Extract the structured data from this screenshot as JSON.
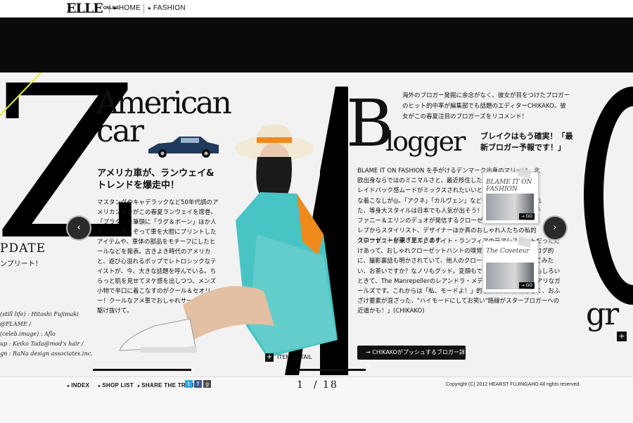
{
  "nav": {
    "logo": "ELLE",
    "logo_sub": "ONLINE",
    "home": "HOME",
    "fashion": "FASHION"
  },
  "left_page": {
    "big_letter": "Z",
    "update_title": "PDATE",
    "update_sub": "ンプリート！",
    "credits": [
      "(still life) : Hitoshi Fujimaki @FLAME /",
      "(celeb.image) : Aflo",
      "up : Keiko Tada@mod's hair /",
      "gn : RaNa design associates.inc."
    ]
  },
  "article_left": {
    "heading_1": "American",
    "heading_2": "car",
    "subheading": "アメリカ車が、ランウェイ&トレンドを爆走中！",
    "body": "マスタングやキャデラックなど50年代調のアメリカンカーがこの春夏ランウェイを席巻。「プラダ」を筆頭に「ラグ＆ボーン」ほか人気メゾンがこぞって車を大胆にプリントしたアイテムや、車体の部品をモチーフにしたヒールなどを発表。古きよき時代のアメリカと、遊び心溢れるポップでレトロシックなテイストが、今、大きな話題を呼んでいる。ちらっと肌を見せてヌケ感を出しつつ、メンズ小物で辛口に着こなすのがクール＆セオリー！クールなアメ車でおしゃれサーキットを駆け抜けて。",
    "item_detail": "ITEM DETAIL"
  },
  "article_right": {
    "intro": "海外のブロガー発掘に余念がなく、彼女が目をつけたブロガーのヒット的中率が編集部でも話題のエディターCHIKAKO。彼女がこの春夏注目のブロガーズをリコメンド！",
    "heading_b": "B",
    "heading_rest": "logger",
    "subheading": "ブレイクはもう確実！「最新ブロガー予報です！」",
    "body_1": "BLAME IT ON FASHION を手がけるデンマーク出身のマリーは、北欧出身ならではのミニマルさと、最近移住したばかりのLA仕込みのレイドバック感ムードがミックスされたいいとこ取りのゆるモードな着こなしが◎。「アクネ」「カルヴェン」など旬ブランドを取り入れた、等身大スタイルは日本でも人気が出そう！The Coveteurはステファニー＆エリンのデュオが発信するクローゼット拝見ブログ。セレブからスタイリスト、デザイナーほか真のおしゃれ人たちの私的クローゼットを覗き見できます。",
    "body_2": "ステファニーが米「エル」のケイト・ランフィアの元アシスタントだっただけあって、おしゃれクローゼットハントの嗅覚も冴えている！裏ブログ的に、撮影裏話も明かされていて、他人のクローゼットでコスプレしてみたい、お茶いですか？なノリもグッド。変顔もできる、コメントもおもしろいときて、The Manrepellerのレアンドラ・メディネに続く、中毒性アリなガールズです。これからは「私、モードよ！」的なアプローチではなく、おふざけ要素が混ざった、\"ハイモードにしてお笑い\"路線がスターブロガーへの近道かも！」(CHIKAKO)",
    "card_1_title": "BLAME IT ON FASHION",
    "card_2_title": "The Coveteur",
    "card_go": "→ GO",
    "cta": "CHIKAKOがプッシュするブロガー詳細"
  },
  "right_page": {
    "fragment": "gr"
  },
  "footer": {
    "index": "INDEX",
    "shop_list": "SHOP LIST",
    "share": "SHARE THE TREND!",
    "page_current": "1",
    "page_total": "/ 18",
    "copyright": "Copyright (C) 2012 HEARST FUJINGAHO All rights reserved."
  },
  "colors": {
    "accent_yellow": "#e8ef2a",
    "twitter": "#3aa3e3",
    "facebook": "#3b5998"
  }
}
